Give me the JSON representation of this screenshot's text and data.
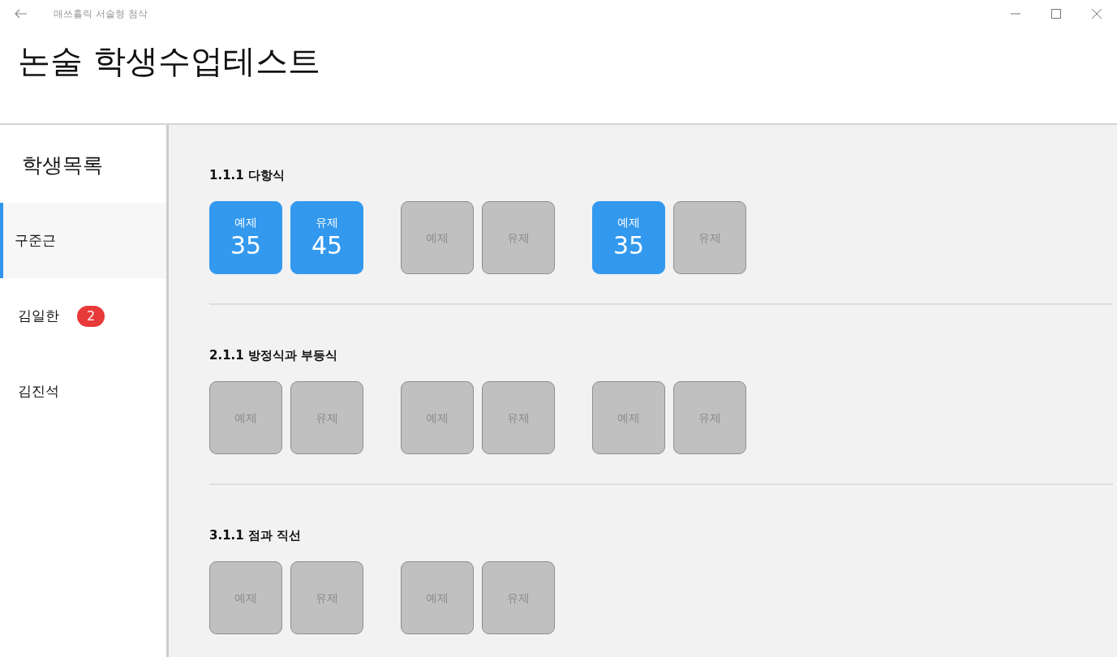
{
  "window": {
    "title": "매쓰홀릭 서술형 첨삭"
  },
  "page_title": "논술 학생수업테스트",
  "sidebar": {
    "heading": "학생목록",
    "students": [
      {
        "name": "구준근",
        "selected": true
      },
      {
        "name": "김일한",
        "selected": false,
        "badge": "2"
      },
      {
        "name": "김진석",
        "selected": false
      }
    ]
  },
  "sections": [
    {
      "title": "1.1.1 다항식",
      "groups": [
        {
          "tiles": [
            {
              "label": "예제",
              "done": true,
              "score": "35"
            },
            {
              "label": "유제",
              "done": true,
              "score": "45"
            }
          ]
        },
        {
          "tiles": [
            {
              "label": "예제",
              "done": false
            },
            {
              "label": "유제",
              "done": false
            }
          ]
        },
        {
          "tiles": [
            {
              "label": "예제",
              "done": true,
              "score": "35"
            },
            {
              "label": "유제",
              "done": false
            }
          ]
        }
      ]
    },
    {
      "title": "2.1.1 방정식과 부등식",
      "groups": [
        {
          "tiles": [
            {
              "label": "예제",
              "done": false
            },
            {
              "label": "유제",
              "done": false
            }
          ]
        },
        {
          "tiles": [
            {
              "label": "예제",
              "done": false
            },
            {
              "label": "유제",
              "done": false
            }
          ]
        },
        {
          "tiles": [
            {
              "label": "예제",
              "done": false
            },
            {
              "label": "유제",
              "done": false
            }
          ]
        }
      ]
    },
    {
      "title": "3.1.1 점과 직선",
      "groups": [
        {
          "tiles": [
            {
              "label": "예제",
              "done": false
            },
            {
              "label": "유제",
              "done": false
            }
          ]
        },
        {
          "tiles": [
            {
              "label": "예제",
              "done": false
            },
            {
              "label": "유제",
              "done": false
            }
          ]
        }
      ]
    }
  ]
}
